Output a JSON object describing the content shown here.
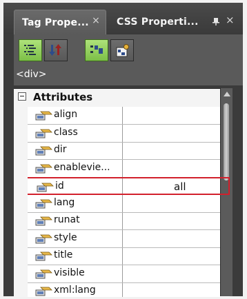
{
  "tabs": [
    {
      "label": "Tag Prope...",
      "close": "×"
    },
    {
      "label": "CSS Properti..."
    }
  ],
  "panel_close": "×",
  "toolbar": {
    "buttons": [
      {
        "icon": "categorized-view-icon",
        "state": "on"
      },
      {
        "icon": "sort-alphabetical-icon",
        "state": "off"
      },
      {
        "icon": "show-set-properties-icon",
        "state": "on"
      },
      {
        "icon": "property-pages-icon",
        "state": "off"
      }
    ]
  },
  "breadcrumb": "<div>",
  "category": {
    "label": "Attributes",
    "expanded": true
  },
  "attributes": [
    {
      "name": "align",
      "value": ""
    },
    {
      "name": "class",
      "value": ""
    },
    {
      "name": "dir",
      "value": ""
    },
    {
      "name": "enablevie...",
      "value": ""
    },
    {
      "name": "id",
      "value": "all",
      "selected": true
    },
    {
      "name": "lang",
      "value": ""
    },
    {
      "name": "runat",
      "value": ""
    },
    {
      "name": "style",
      "value": ""
    },
    {
      "name": "title",
      "value": ""
    },
    {
      "name": "visible",
      "value": ""
    },
    {
      "name": "xml:lang",
      "value": ""
    }
  ],
  "colors": {
    "accent_green": "#8ccf55",
    "selection_border": "#d21f2b",
    "panel_bg": "#3b3b3b"
  }
}
